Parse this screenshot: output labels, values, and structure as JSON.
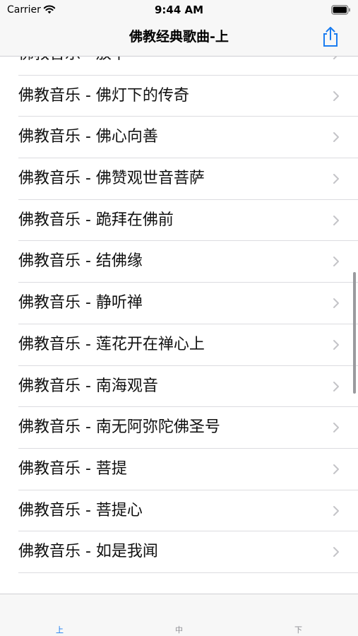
{
  "status_bar": {
    "carrier": "Carrier",
    "time": "9:44 AM"
  },
  "nav": {
    "title": "佛教经典歌曲-上",
    "share_icon": "share-icon"
  },
  "list": {
    "items": [
      "佛教音乐 - 放下",
      "佛教音乐 - 佛灯下的传奇",
      "佛教音乐 - 佛心向善",
      "佛教音乐 - 佛赞观世音菩萨",
      "佛教音乐 - 跪拜在佛前",
      "佛教音乐 - 结佛缘",
      "佛教音乐 - 静听禅",
      "佛教音乐 - 莲花开在禅心上",
      "佛教音乐 - 南海观音",
      "佛教音乐 - 南无阿弥陀佛圣号",
      "佛教音乐 - 菩提",
      "佛教音乐 - 菩提心",
      "佛教音乐 - 如是我闻",
      ""
    ]
  },
  "tabs": [
    {
      "label": "上",
      "selected": true
    },
    {
      "label": "中",
      "selected": false
    },
    {
      "label": "下",
      "selected": false
    }
  ],
  "colors": {
    "accent": "#1a7cf0",
    "inactive_tab": "#8e8e93",
    "chevron": "#c4c4c8",
    "text": "#111111"
  }
}
